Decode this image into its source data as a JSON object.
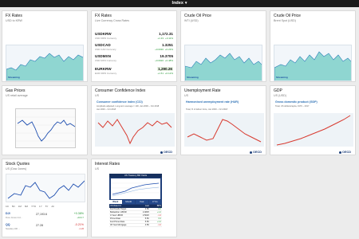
{
  "header": {
    "title": "Index"
  },
  "cards": {
    "fx1": {
      "title": "FX Rates",
      "subtitle": "USD to KRW",
      "legend": "Streaming"
    },
    "fx2": {
      "title": "FX Rates",
      "subtitle": "Live Currency Cross Rates",
      "rows": [
        {
          "symbol": "USDKRW",
          "value": "1,172.31",
          "sub": "USD KRW Currency",
          "change": "+1.33",
          "pct": "+0.11%"
        },
        {
          "symbol": "USDCAD",
          "value": "1.3251",
          "sub": "USD CAD Currency",
          "change": "+0.0030",
          "pct": "+0.23%"
        },
        {
          "symbol": "USDMXN",
          "value": "19.3705",
          "sub": "USD MXN Currency",
          "change": "+0.0920",
          "pct": "+0.48%"
        },
        {
          "symbol": "EURKRW",
          "value": "1,290.26",
          "sub": "EUR KRW Currency",
          "change": "+1.51",
          "pct": "+0.12%"
        }
      ]
    },
    "oil1": {
      "title": "Crude Oil Price",
      "subtitle": "WTI (USD)",
      "legend": "Streaming"
    },
    "oil2": {
      "title": "Crude Oil Price",
      "subtitle": "Brent Spot (USD)",
      "legend": "Streaming"
    },
    "gas": {
      "title": "Gas Prices",
      "subtitle": "US retail average"
    },
    "cci": {
      "title": "Consumer Confidence Index",
      "subtitle": "US",
      "inner_title": "Consumer confidence index (CCI)",
      "inner_sub1": "Amplitude adjusted, Long-term average = 100, Jan 2000 – Oct 2018",
      "inner_sub2": "Jan 2000 – Oct 2018",
      "logo": "OECD"
    },
    "unemp": {
      "title": "Unemployment Rate",
      "subtitle": "US",
      "inner_title": "Harmonised unemployment rate (HUR)",
      "inner_sub1": "Total, % of labour force, Jan 2000 – Oct 2018",
      "logo": "OECD"
    },
    "gdp": {
      "title": "GDP",
      "subtitle": "US (USD)",
      "inner_title": "Gross domestic product (GDP)",
      "inner_sub1": "Total, US dollars/capita, 1970 – 2017",
      "logo": "OECD"
    },
    "stocks": {
      "title": "Stock Quotes",
      "subtitle": "US (Dow Jones)",
      "periods": [
        "1D",
        "5D",
        "1M",
        "6M",
        "YTD",
        "1Y",
        "5Y",
        "All"
      ],
      "rows": [
        {
          "symbol": "DJI",
          "name": "Dow Jones Ind...",
          "price": "27,193.6",
          "change": "+0.38%",
          "change2": "+104.7",
          "negative": false
        },
        {
          "symbol": "QQ",
          "name": "Nasdaq 100 ...",
          "price": "27.28",
          "change": "-0.21%",
          "change2": "-1.26",
          "negative": true
        }
      ]
    },
    "rates": {
      "title": "Interest Rates",
      "subtitle": "US",
      "chart_title": "US Treasury Bill Yields",
      "tabs": [
        "Week",
        "Month",
        "Year",
        "3 Yrs"
      ],
      "table_head": [
        "US Rate Fd",
        "Last",
        "BPS"
      ],
      "rows": [
        {
          "name": "Fed Funds Target",
          "last": "2.50",
          "bps": "0.0",
          "negative": false
        },
        {
          "name": "Bellwether LIBOR",
          "last": "2.4825",
          "bps": "+1.2",
          "negative": false
        },
        {
          "name": "3-Year LIBOR",
          "last": "2.5026",
          "bps": "-1.4",
          "negative": true
        },
        {
          "name": "Prime Rate",
          "last": "5.50",
          "bps": "0.0",
          "negative": false
        },
        {
          "name": "Fed Prime Rate",
          "last": "5.50",
          "bps": "+1.2",
          "negative": false
        },
        {
          "name": "30 Year Mortgage",
          "last": "4.59",
          "bps": "-1.2",
          "negative": true
        }
      ]
    }
  },
  "colors": {
    "area": "#8fd6d1",
    "area_line": "#2c7fb8",
    "oecd_line": "#d83a2f",
    "brand": "#1d3f7a"
  }
}
